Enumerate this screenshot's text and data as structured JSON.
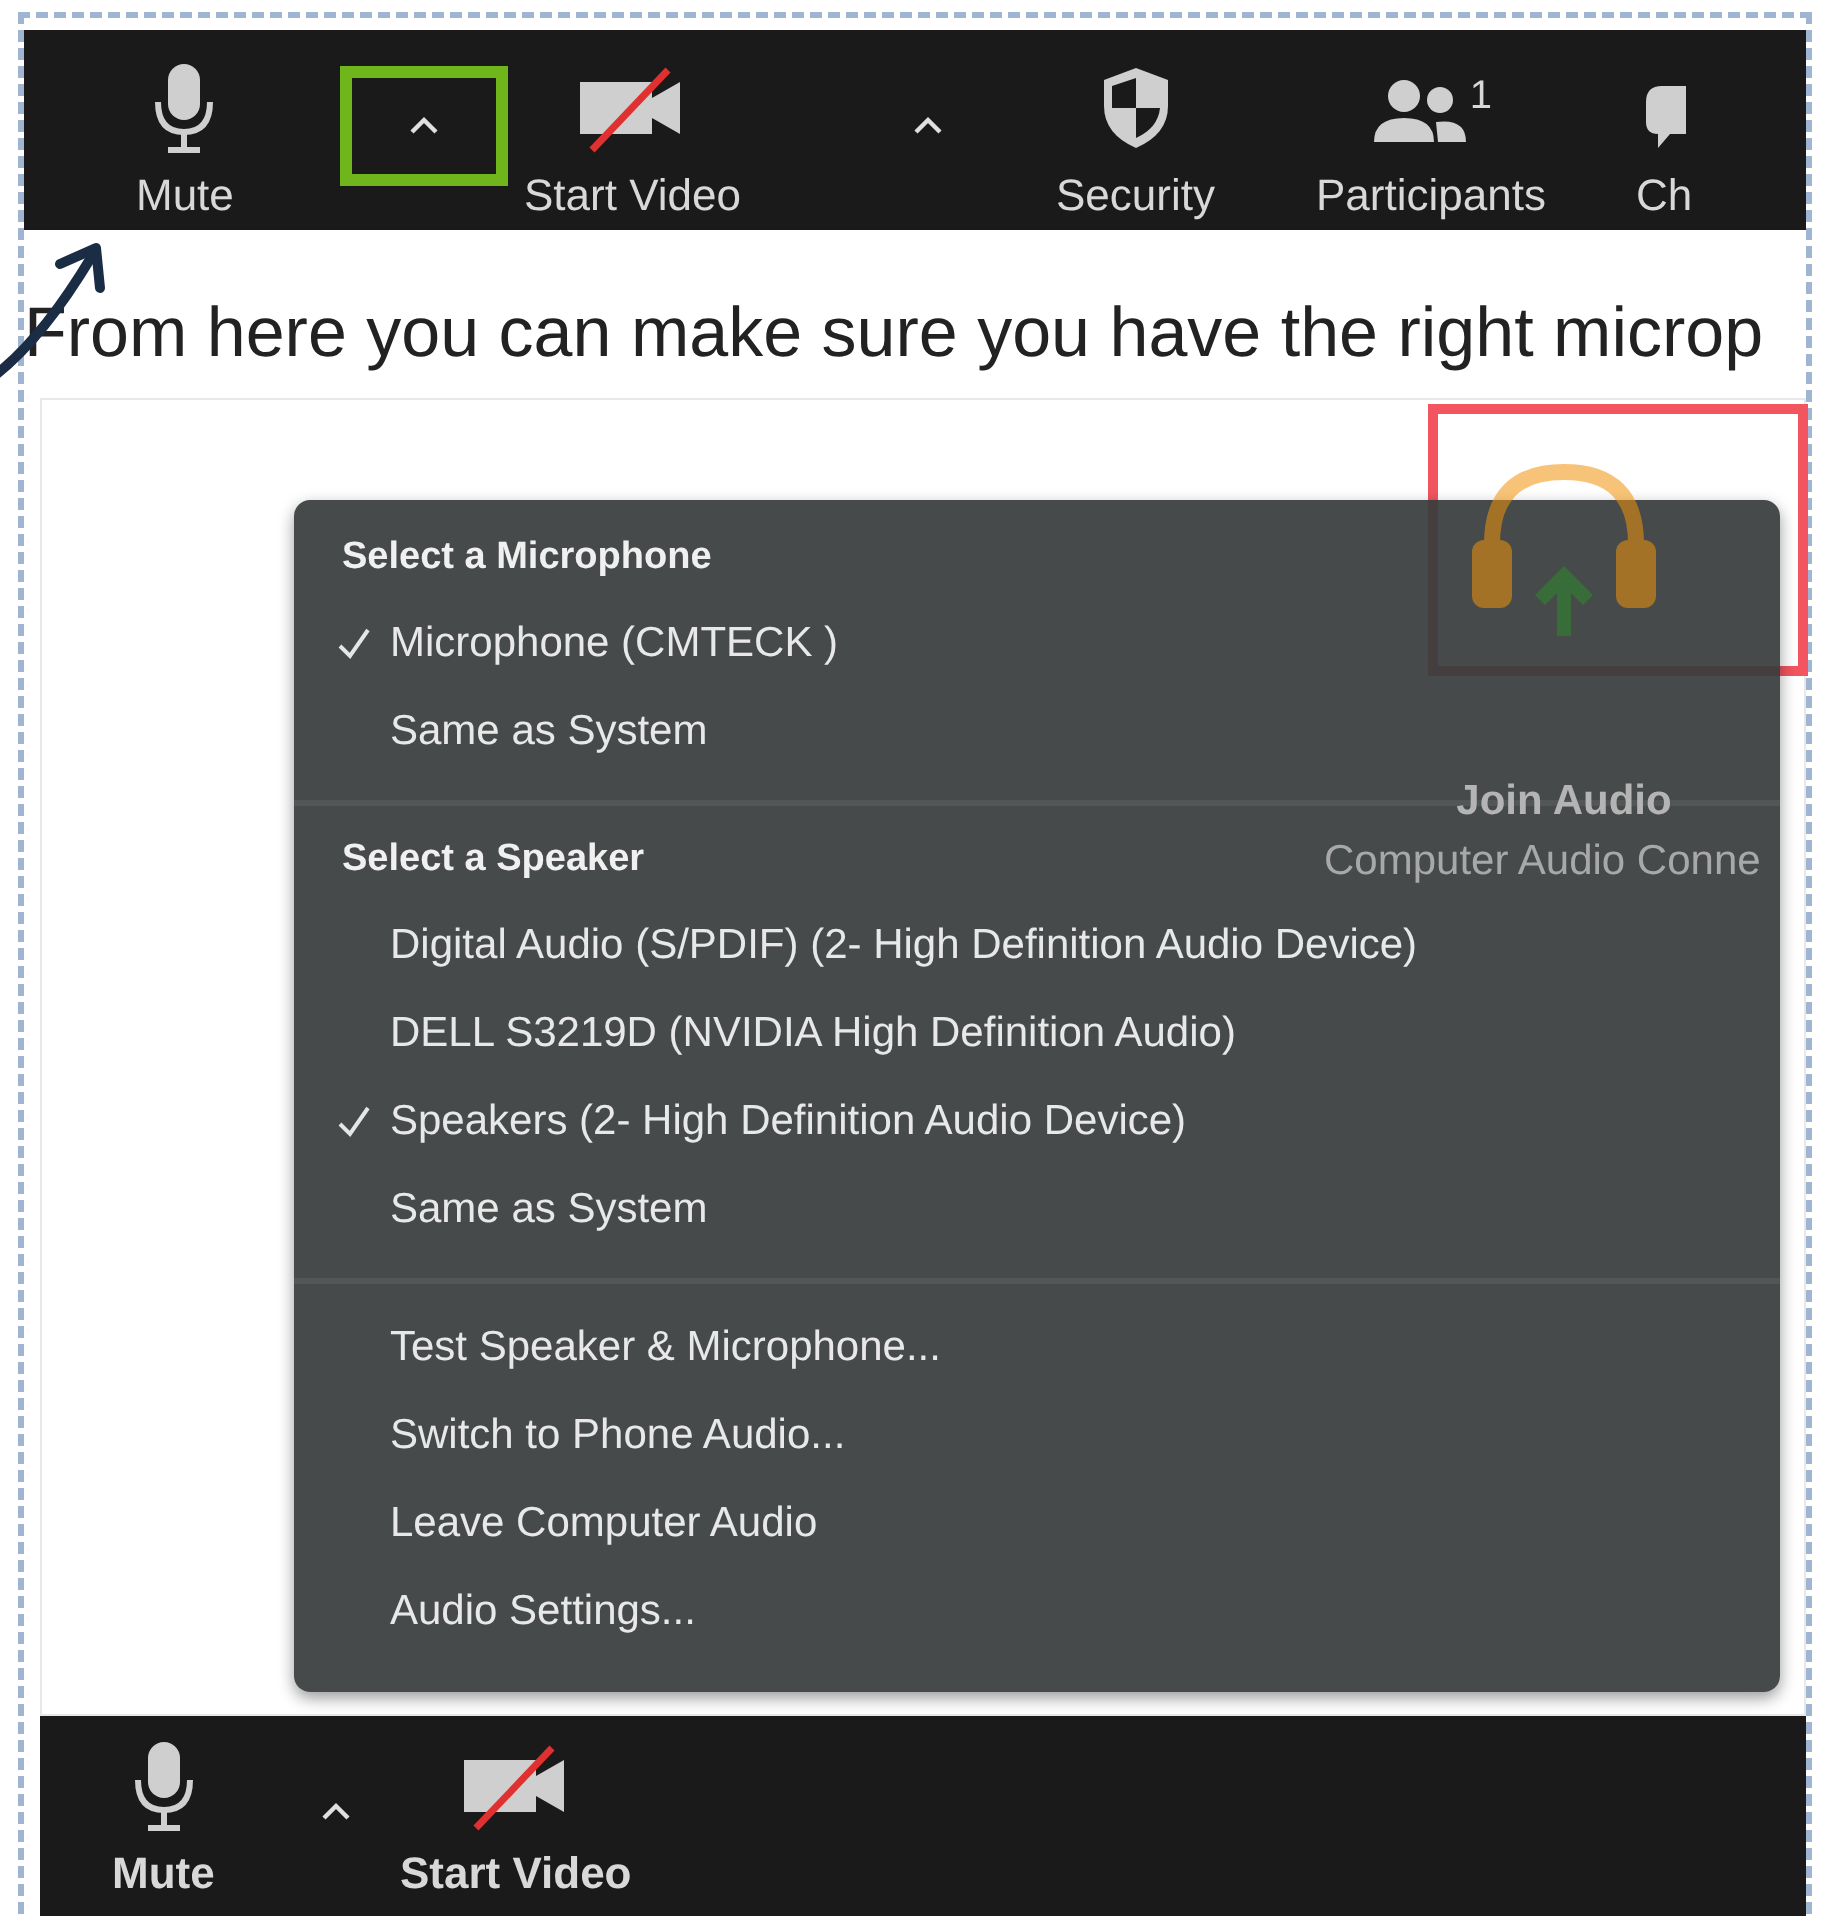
{
  "top_toolbar": {
    "items": [
      {
        "kind": "mic",
        "label": "Mute",
        "menu_caret": true,
        "caret_highlighted": true
      },
      {
        "kind": "video",
        "label": "Start Video",
        "menu_caret": true,
        "caret_highlighted": false
      },
      {
        "kind": "security",
        "label": "Security",
        "menu_caret": false,
        "caret_highlighted": false
      },
      {
        "kind": "participants",
        "label": "Participants",
        "count": "1",
        "menu_caret": false,
        "caret_highlighted": false
      },
      {
        "kind": "chat",
        "label": "Ch",
        "menu_caret": false,
        "caret_highlighted": false
      }
    ]
  },
  "caption": "From here you can make sure you have the right microp",
  "join_audio": {
    "title": "Join Audio",
    "subtitle": "Computer Audio Conne",
    "highlighted": true
  },
  "audio_menu": {
    "sections": [
      {
        "heading": "Select a Microphone",
        "items": [
          {
            "label": "Microphone (CMTECK     )",
            "checked": true
          },
          {
            "label": "Same as System",
            "checked": false
          }
        ]
      },
      {
        "heading": "Select a Speaker",
        "items": [
          {
            "label": "Digital Audio (S/PDIF) (2- High Definition Audio Device)",
            "checked": false
          },
          {
            "label": "DELL S3219D (NVIDIA High Definition Audio)",
            "checked": false
          },
          {
            "label": "Speakers (2- High Definition Audio Device)",
            "checked": true
          },
          {
            "label": "Same as System",
            "checked": false
          }
        ]
      },
      {
        "items": [
          {
            "label": "Test Speaker & Microphone...",
            "checked": false
          },
          {
            "label": "Switch to Phone Audio...",
            "checked": false
          },
          {
            "label": "Leave Computer Audio",
            "checked": false
          },
          {
            "label": "Audio Settings...",
            "checked": false
          }
        ]
      }
    ]
  },
  "bottom_toolbar": {
    "items": [
      {
        "kind": "mic",
        "label": "Mute",
        "menu_caret": true,
        "caret_highlighted": false
      },
      {
        "kind": "video",
        "label": "Start Video",
        "menu_caret": false,
        "caret_highlighted": false
      }
    ]
  }
}
